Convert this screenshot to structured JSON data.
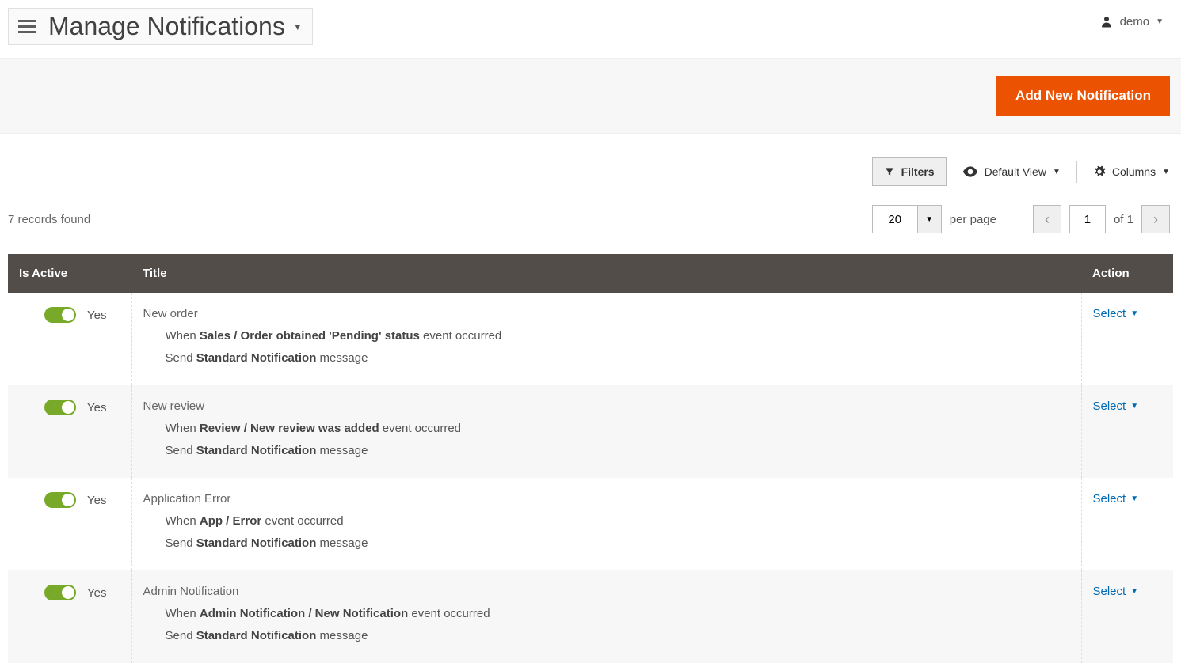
{
  "header": {
    "page_title": "Manage Notifications",
    "user_name": "demo"
  },
  "actions": {
    "add_new": "Add New Notification"
  },
  "toolbar": {
    "filters": "Filters",
    "default_view": "Default View",
    "columns": "Columns"
  },
  "controls": {
    "records_found": "7 records found",
    "per_page_value": "20",
    "per_page_label": "per page",
    "current_page": "1",
    "of_total": "of 1"
  },
  "table": {
    "columns": {
      "is_active": "Is Active",
      "title": "Title",
      "action": "Action"
    },
    "toggle_yes": "Yes",
    "select_label": "Select",
    "line_when": "When ",
    "line_event": " event occurred",
    "line_send": "Send ",
    "line_message": " message",
    "rows": [
      {
        "title": "New order",
        "event": "Sales / Order obtained 'Pending' status",
        "send": "Standard Notification"
      },
      {
        "title": "New review",
        "event": "Review / New review was added",
        "send": "Standard Notification"
      },
      {
        "title": "Application Error",
        "event": "App / Error",
        "send": "Standard Notification"
      },
      {
        "title": "Admin Notification",
        "event": "Admin Notification / New Notification",
        "send": "Standard Notification"
      }
    ]
  }
}
